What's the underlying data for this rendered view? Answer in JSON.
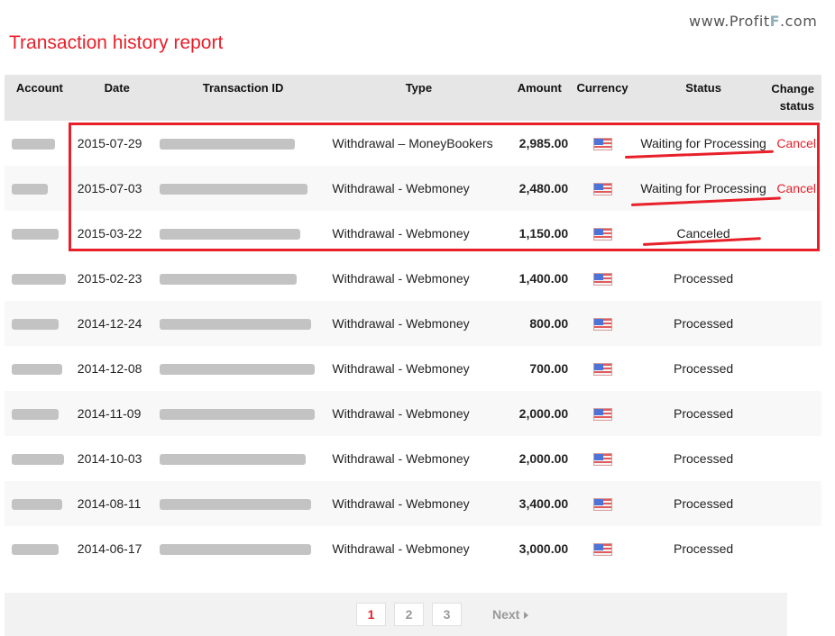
{
  "watermark": {
    "prefix": "www.Profit",
    "letter": "F",
    "suffix": ".com"
  },
  "page_title": "Transaction history report",
  "table": {
    "headers": {
      "account": "Account",
      "date": "Date",
      "transaction_id": "Transaction ID",
      "type": "Type",
      "amount": "Amount",
      "currency": "Currency",
      "status": "Status",
      "change_status_line1": "Change",
      "change_status_line2": "status"
    },
    "rows": [
      {
        "date": "2015-07-29",
        "type": "Withdrawal – MoneyBookers",
        "amount": "2,985.00",
        "currency": "us-flag-icon",
        "status": "Waiting for Processing",
        "action": "Cancel"
      },
      {
        "date": "2015-07-03",
        "type": "Withdrawal - Webmoney",
        "amount": "2,480.00",
        "currency": "us-flag-icon",
        "status": "Waiting for Processing",
        "action": "Cancel"
      },
      {
        "date": "2015-03-22",
        "type": "Withdrawal - Webmoney",
        "amount": "1,150.00",
        "currency": "us-flag-icon",
        "status": "Canceled",
        "action": ""
      },
      {
        "date": "2015-02-23",
        "type": "Withdrawal - Webmoney",
        "amount": "1,400.00",
        "currency": "us-flag-icon",
        "status": "Processed",
        "action": ""
      },
      {
        "date": "2014-12-24",
        "type": "Withdrawal - Webmoney",
        "amount": "800.00",
        "currency": "us-flag-icon",
        "status": "Processed",
        "action": ""
      },
      {
        "date": "2014-12-08",
        "type": "Withdrawal - Webmoney",
        "amount": "700.00",
        "currency": "us-flag-icon",
        "status": "Processed",
        "action": ""
      },
      {
        "date": "2014-11-09",
        "type": "Withdrawal - Webmoney",
        "amount": "2,000.00",
        "currency": "us-flag-icon",
        "status": "Processed",
        "action": ""
      },
      {
        "date": "2014-10-03",
        "type": "Withdrawal - Webmoney",
        "amount": "2,000.00",
        "currency": "us-flag-icon",
        "status": "Processed",
        "action": ""
      },
      {
        "date": "2014-08-11",
        "type": "Withdrawal - Webmoney",
        "amount": "3,400.00",
        "currency": "us-flag-icon",
        "status": "Processed",
        "action": ""
      },
      {
        "date": "2014-06-17",
        "type": "Withdrawal - Webmoney",
        "amount": "3,000.00",
        "currency": "us-flag-icon",
        "status": "Processed",
        "action": ""
      }
    ]
  },
  "pagination": {
    "pages": [
      "1",
      "2",
      "3"
    ],
    "current": "1",
    "next_label": "Next"
  },
  "colors": {
    "accent": "#e8202a",
    "header_bg": "#e6e6e6",
    "pager_bg": "#f2f2f2"
  }
}
